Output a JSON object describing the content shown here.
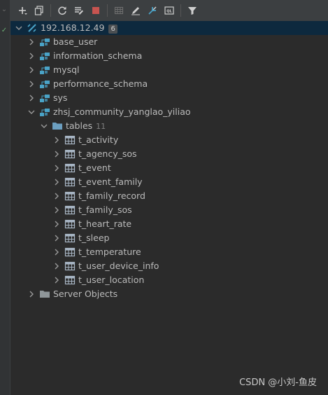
{
  "toolbar": {
    "buttons": [
      {
        "name": "add-icon"
      },
      {
        "name": "duplicate-icon"
      },
      {
        "sep": true
      },
      {
        "name": "refresh-icon"
      },
      {
        "name": "properties-icon"
      },
      {
        "name": "stop-icon"
      },
      {
        "sep": true
      },
      {
        "name": "table-view-icon"
      },
      {
        "name": "edit-icon"
      },
      {
        "name": "jump-icon"
      },
      {
        "name": "console-icon"
      },
      {
        "sep": true
      },
      {
        "name": "filter-icon"
      }
    ]
  },
  "tree": {
    "connection": {
      "label": "192.168.12.49",
      "count": "6"
    },
    "databases": [
      "base_user",
      "information_schema",
      "mysql",
      "performance_schema",
      "sys",
      "zhsj_community_yanglao_yiliao"
    ],
    "tables_folder": {
      "label": "tables",
      "count": "11"
    },
    "tables": [
      "t_activity",
      "t_agency_sos",
      "t_event",
      "t_event_family",
      "t_family_record",
      "t_family_sos",
      "t_heart_rate",
      "t_sleep",
      "t_temperature",
      "t_user_device_info",
      "t_user_location"
    ],
    "server_objects": "Server Objects"
  },
  "watermark": "CSDN @小刘-鱼皮",
  "colors": {
    "selection": "#0d293e",
    "db_icon": "#4aa3c7",
    "folder_icon": "#6c9fc0",
    "table_icon": "#a9b7c6"
  }
}
